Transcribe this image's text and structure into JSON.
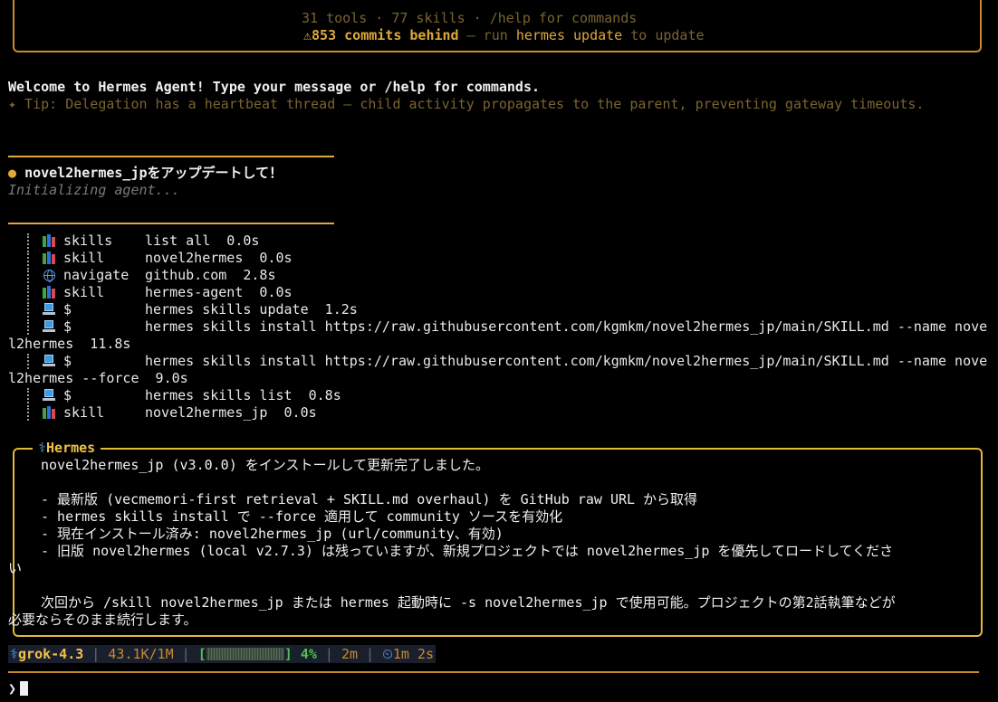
{
  "banner": {
    "tools_line": "31 tools · 77 skills · /help for commands",
    "warning_icon": "⚠",
    "commits_behind": "853 commits behind",
    "update_hint_dash": " — run ",
    "update_cmd": "hermes update",
    "update_hint_tail": " to update"
  },
  "welcome": "Welcome to Hermes Agent! Type your message or /help for commands.",
  "tip": "✦ Tip: Delegation has a heartbeat thread — child activity propagates to the parent, preventing gateway timeouts.",
  "user_message": {
    "bullet": "●",
    "text": "novel2hermes_jpをアップデートして！",
    "status": "Initializing agent..."
  },
  "tools": [
    {
      "icon": "books-icon",
      "name": "skills",
      "args": "list all  0.0s"
    },
    {
      "icon": "books-icon",
      "name": "skill",
      "args": "novel2hermes  0.0s"
    },
    {
      "icon": "globe-icon",
      "name": "navigate",
      "args": "github.com  2.8s"
    },
    {
      "icon": "books-icon",
      "name": "skill",
      "args": "hermes-agent  0.0s"
    },
    {
      "icon": "laptop-icon",
      "name": "$",
      "args": "hermes skills update  1.2s"
    },
    {
      "icon": "laptop-icon",
      "name": "$",
      "args": "hermes skills install https://raw.githubusercontent.com/kgmkm/novel2hermes_jp/main/SKILL.md --name nove"
    },
    {
      "icon": "",
      "name": "",
      "args": "l2hermes  11.8s",
      "continuation": true
    },
    {
      "icon": "laptop-icon",
      "name": "$",
      "args": "hermes skills install https://raw.githubusercontent.com/kgmkm/novel2hermes_jp/main/SKILL.md --name nove"
    },
    {
      "icon": "",
      "name": "",
      "args": "l2hermes --force  9.0s",
      "continuation": true
    },
    {
      "icon": "laptop-icon",
      "name": "$",
      "args": "hermes skills list  0.8s"
    },
    {
      "icon": "books-icon",
      "name": "skill",
      "args": "novel2hermes_jp  0.0s"
    }
  ],
  "response": {
    "title_icon": "⚕",
    "title": "Hermes",
    "lines": [
      "novel2hermes_jp (v3.0.0) をインストールして更新完了しました。",
      "",
      "- 最新版 (vecmemori-first retrieval + SKILL.md overhaul) を GitHub raw URL から取得",
      "- hermes skills install で --force 適用して community ソースを有効化",
      "- 現在インストール済み: novel2hermes_jp (url/community、有効)",
      "- 旧版 novel2hermes (local v2.7.3) は残っていますが、新規プロジェクトでは novel2hermes_jp を優先してロードしてくださ",
      "い",
      "",
      "次回から /skill novel2hermes_jp または hermes 起動時に -s novel2hermes_jp で使用可能。プロジェクトの第2話執筆などが",
      "必要ならそのまま続行します。"
    ]
  },
  "statusbar": {
    "model_icon": "⚕",
    "model": "grok-4.3",
    "tokens": "43.1K/1M",
    "bracket_open": "[",
    "bracket_close": "]",
    "context_percent": 4,
    "percent_label": "4%",
    "elapsed": "2m",
    "timer_icon": "⏲",
    "timer": "1m 2s"
  },
  "prompt_symbol": "❯"
}
